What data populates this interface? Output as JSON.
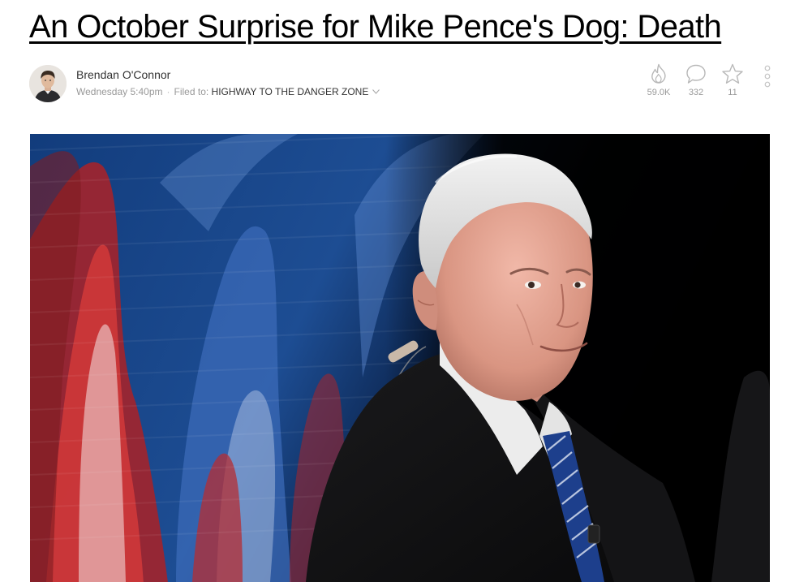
{
  "article": {
    "headline": "An October Surprise for Mike Pence's Dog: Death"
  },
  "byline": {
    "author": "Brendan O'Connor",
    "timestamp": "Wednesday 5:40pm",
    "separator": "·",
    "filed_label": "Filed to:",
    "filed_tag": "HIGHWAY TO THE DANGER ZONE"
  },
  "stats": {
    "views": "59.0K",
    "comments": "332",
    "stars": "11"
  },
  "icons": {
    "views": "flame-icon",
    "comments": "speech-bubble-icon",
    "stars": "star-icon",
    "more": "vertical-ellipsis-icon",
    "tag_menu": "chevron-down-icon"
  },
  "colors": {
    "headline": "#000000",
    "meta": "#999999",
    "icon": "#bbbbbb"
  }
}
